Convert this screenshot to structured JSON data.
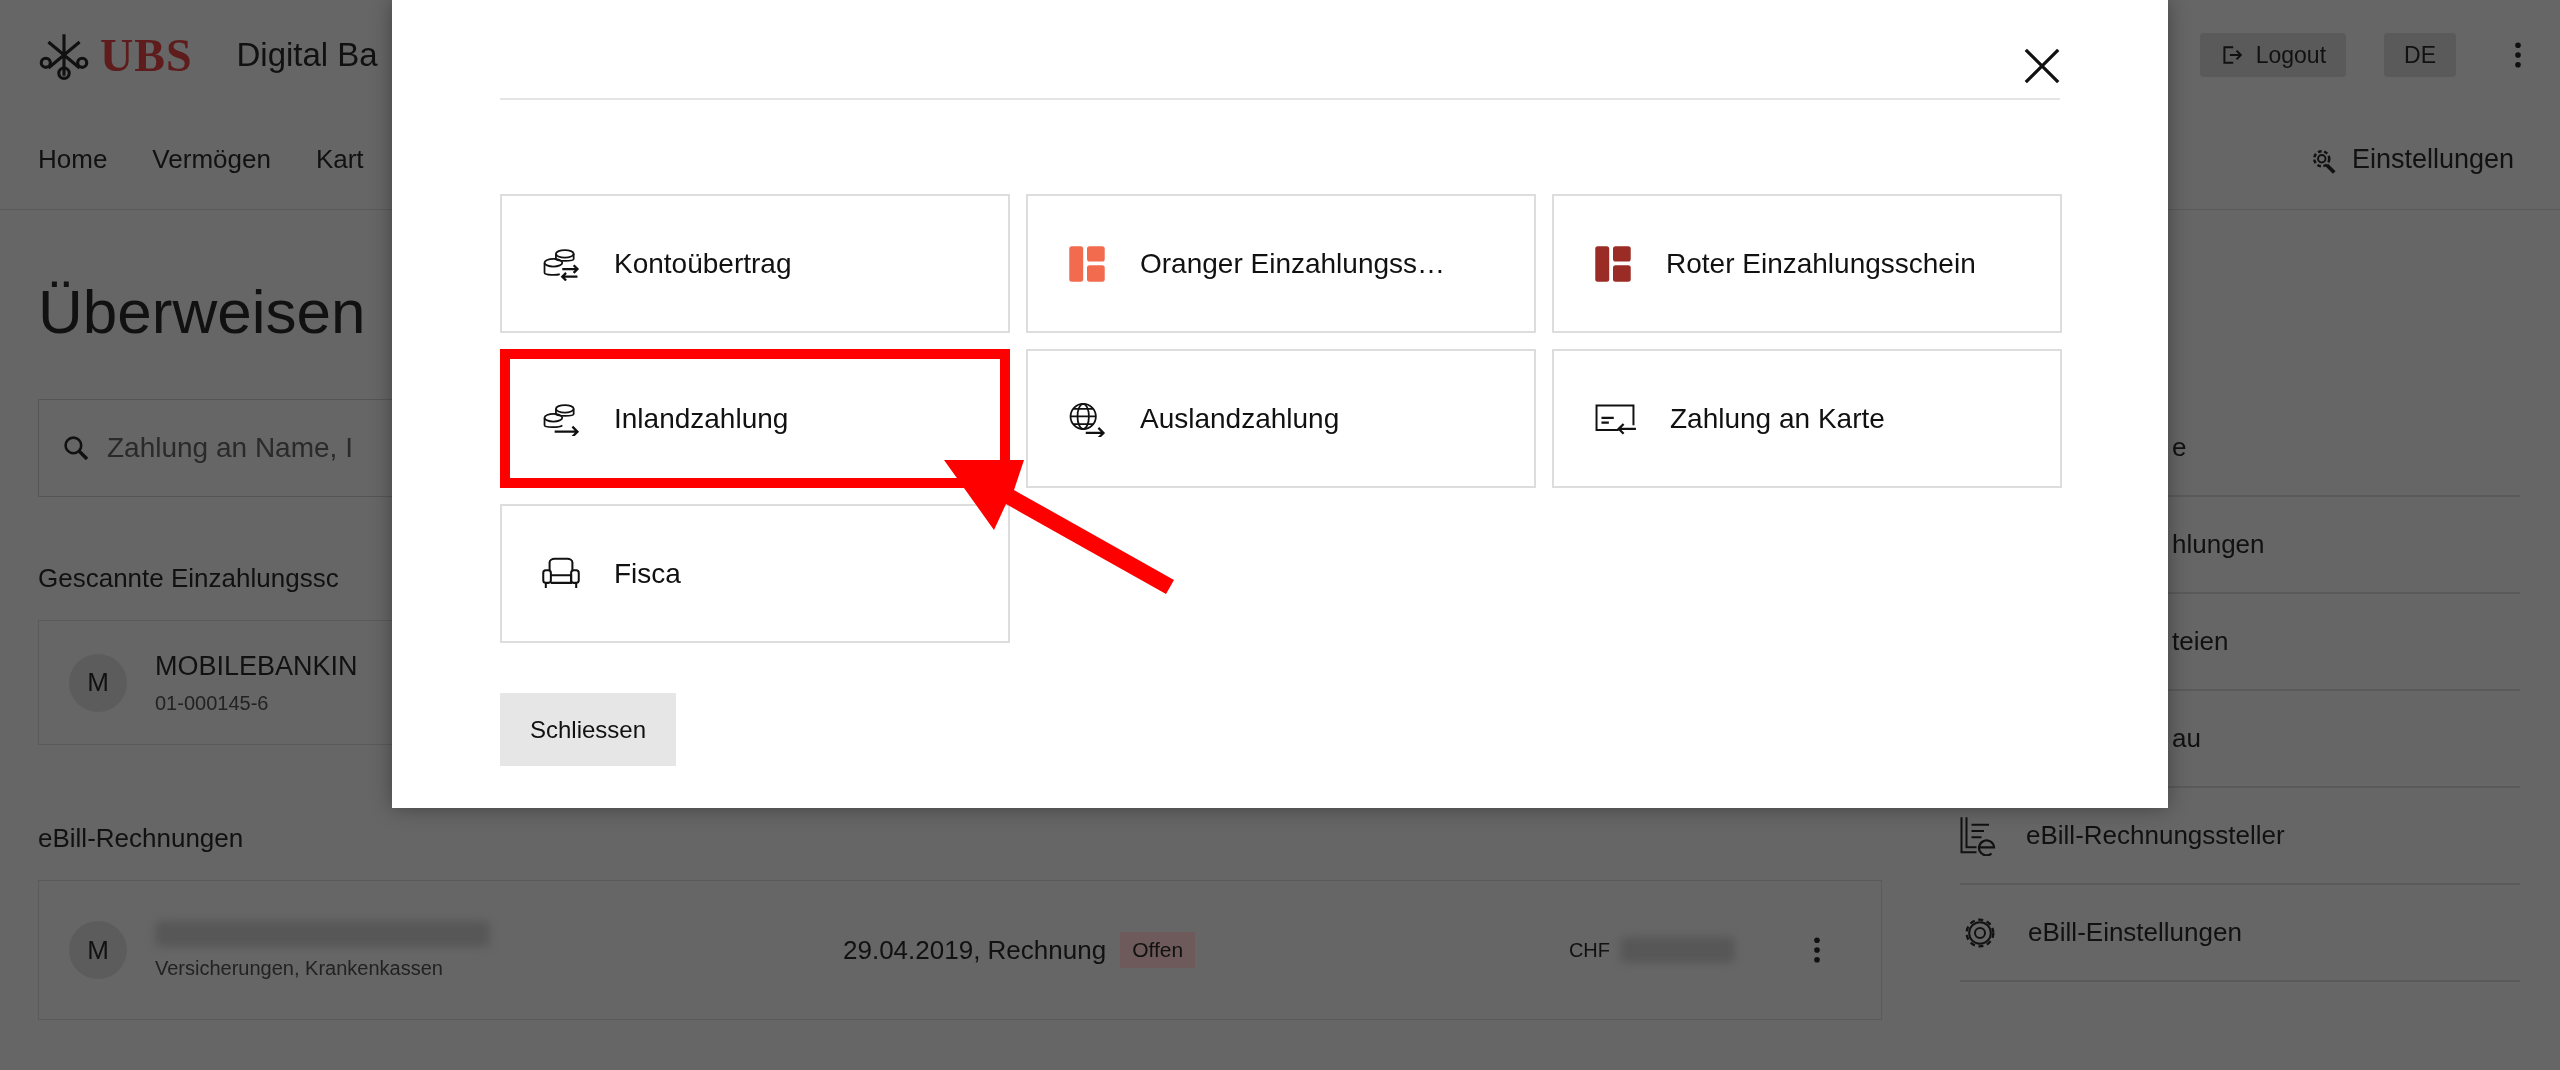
{
  "header": {
    "brand": "UBS",
    "product": "Digital Ba",
    "logout": "Logout",
    "language": "DE"
  },
  "nav": {
    "items": [
      "Home",
      "Vermögen",
      "Kart"
    ],
    "settings": "Einstellungen"
  },
  "page": {
    "title": "Überweisen",
    "search": {
      "placeholder": "Zahlung an Name, I"
    },
    "scanned": {
      "heading": "Gescannte Einzahlungssc",
      "items": [
        {
          "avatar": "M",
          "name": "MOBILEBANKIN",
          "account": "01-000145-6"
        }
      ]
    },
    "ebill": {
      "heading": "eBill-Rechnungen",
      "items": [
        {
          "avatar": "M",
          "category": "Versicherungen, Krankenkassen",
          "date": "29.04.2019, Rechnung",
          "status": "Offen",
          "currency": "CHF"
        }
      ]
    }
  },
  "sidebar": {
    "items": [
      {
        "kind": "clipped",
        "label": "e"
      },
      {
        "kind": "clipped",
        "label": "hlungen"
      },
      {
        "kind": "clipped",
        "label": "teien"
      },
      {
        "kind": "clipped",
        "label": "au"
      },
      {
        "kind": "bills",
        "label": "eBill-Rechnungssteller"
      },
      {
        "kind": "settings",
        "label": "eBill-Einstellungen"
      }
    ]
  },
  "dialog": {
    "tiles": [
      {
        "kind": "transfer",
        "label": "Kontoübertrag",
        "highlighted": false
      },
      {
        "kind": "slip",
        "color": "#f26b4f",
        "label": "Oranger Einzahlungss…",
        "highlighted": false
      },
      {
        "kind": "slip",
        "color": "#9b2b25",
        "label": "Roter Einzahlungsschein",
        "highlighted": false
      },
      {
        "kind": "domestic",
        "label": "Inlandzahlung",
        "highlighted": true
      },
      {
        "kind": "foreign",
        "label": "Auslandzahlung",
        "highlighted": false
      },
      {
        "kind": "card",
        "label": "Zahlung an Karte",
        "highlighted": false
      },
      {
        "kind": "tax",
        "label": "Fisca",
        "highlighted": false
      }
    ],
    "close_button": "Schliessen"
  }
}
